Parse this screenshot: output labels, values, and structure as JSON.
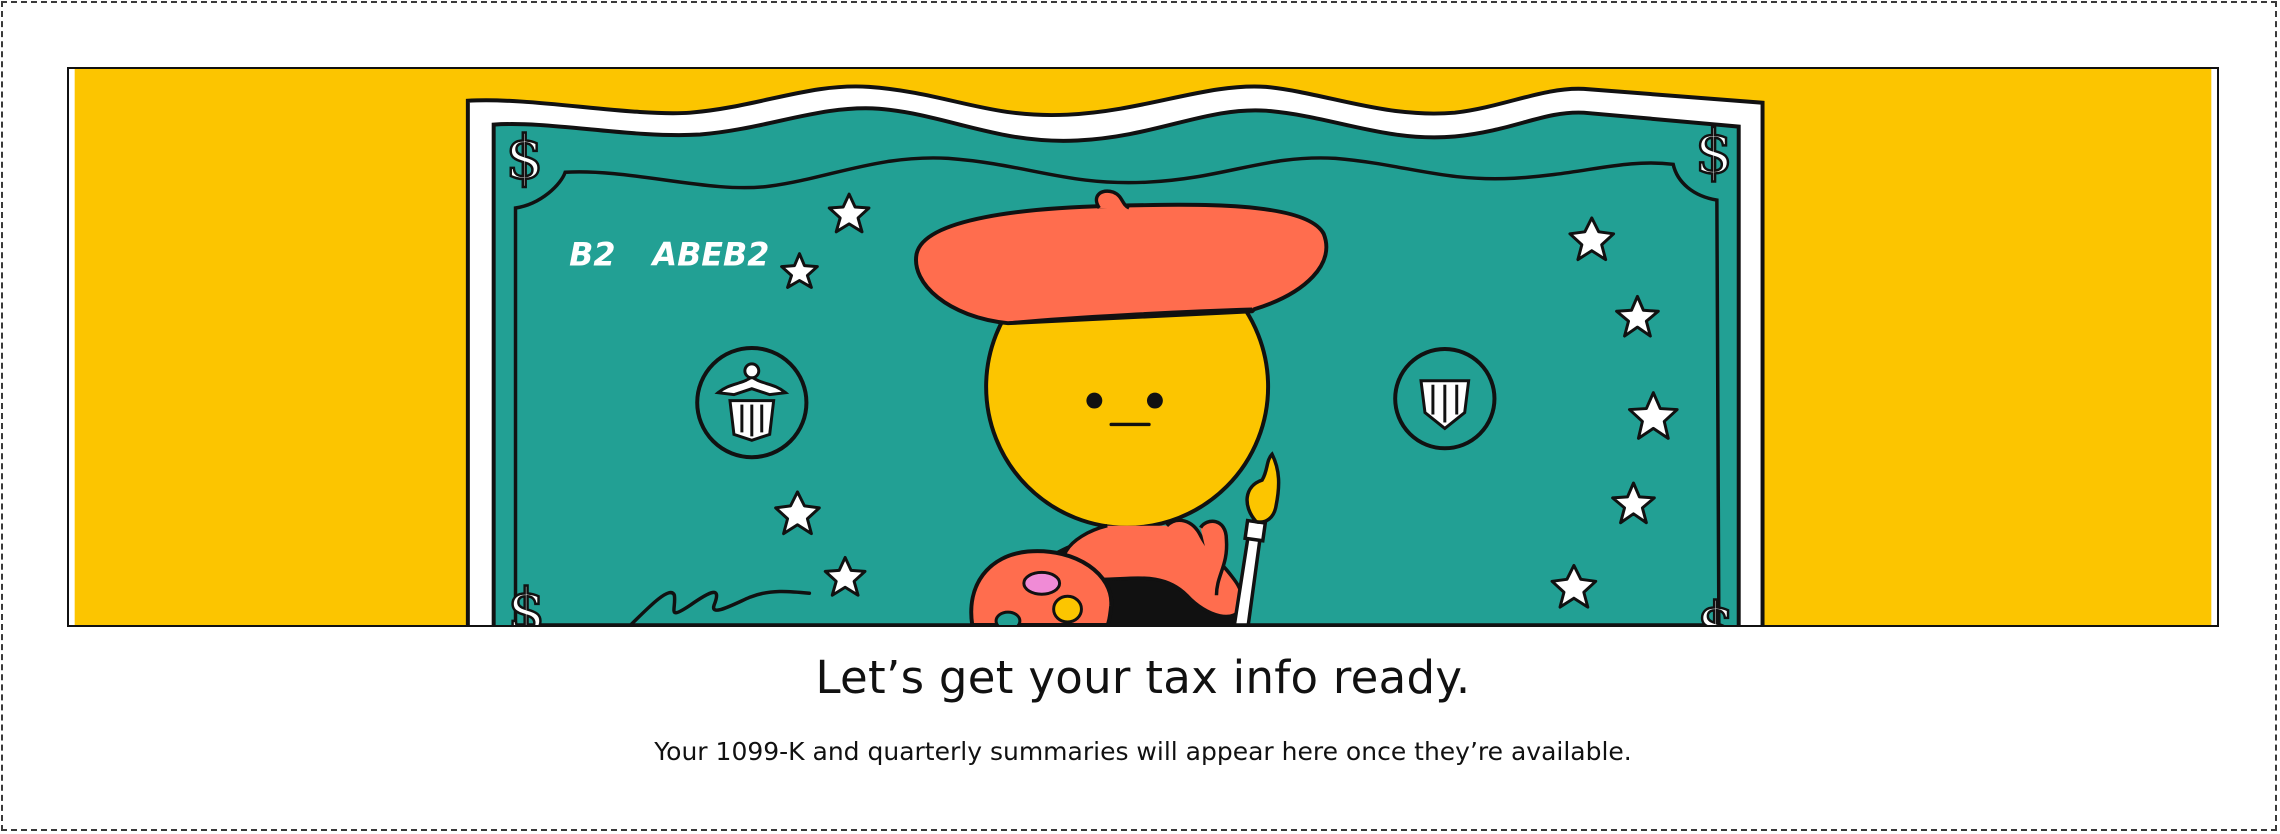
{
  "hero": {
    "serial_left": "B2",
    "serial_right": "ABEB2",
    "currency_symbol": "$",
    "colors": {
      "background": "#FCC500",
      "note": "#22A094",
      "beret": "#FF6D4E",
      "face": "#FCC500"
    }
  },
  "empty_state": {
    "title": "Let’s get your tax info ready.",
    "message": "Your 1099-K and quarterly summaries will appear here once they’re available."
  }
}
